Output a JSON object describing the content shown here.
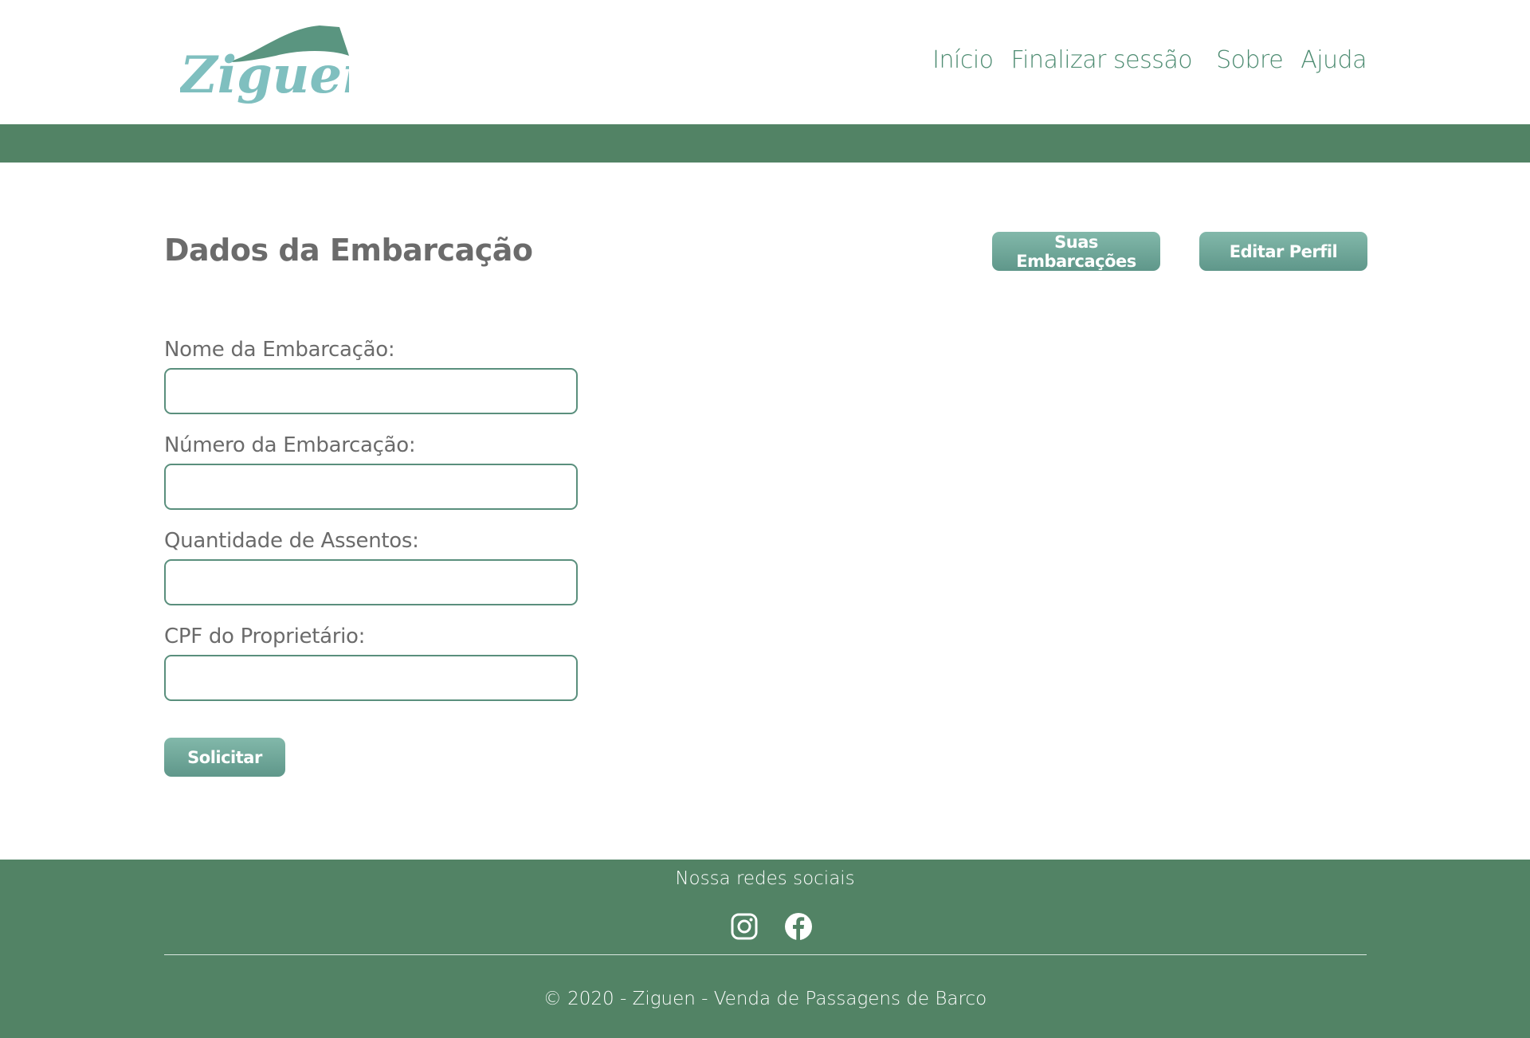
{
  "brand": {
    "name": "Ziguen",
    "color": "#7fbfbf",
    "accent": "#5a9580"
  },
  "nav": {
    "items": [
      {
        "label": "Início"
      },
      {
        "label": "Finalizar sessão"
      },
      {
        "label": "Sobre"
      },
      {
        "label": "Ajuda"
      }
    ]
  },
  "main": {
    "title": "Dados da Embarcação",
    "buttons": {
      "embarcacoes": "Suas Embarcações",
      "perfil": "Editar Perfil"
    },
    "form": {
      "fields": [
        {
          "label": "Nome da Embarcação:",
          "value": ""
        },
        {
          "label": "Número da Embarcação:",
          "value": ""
        },
        {
          "label": "Quantidade de Assentos:",
          "value": ""
        },
        {
          "label": "CPF do Proprietário:",
          "value": ""
        }
      ],
      "submit": "Solicitar"
    }
  },
  "footer": {
    "title": "Nossa redes sociais",
    "social": [
      "instagram-icon",
      "facebook-icon"
    ],
    "copyright": "© 2020 - Ziguen - Venda de Passagens de Barco"
  },
  "colors": {
    "band": "#528365",
    "nav_text": "#4e8c72",
    "button_top": "#82b8aa",
    "button_bottom": "#5f978a",
    "input_border": "#5a8f7d"
  }
}
